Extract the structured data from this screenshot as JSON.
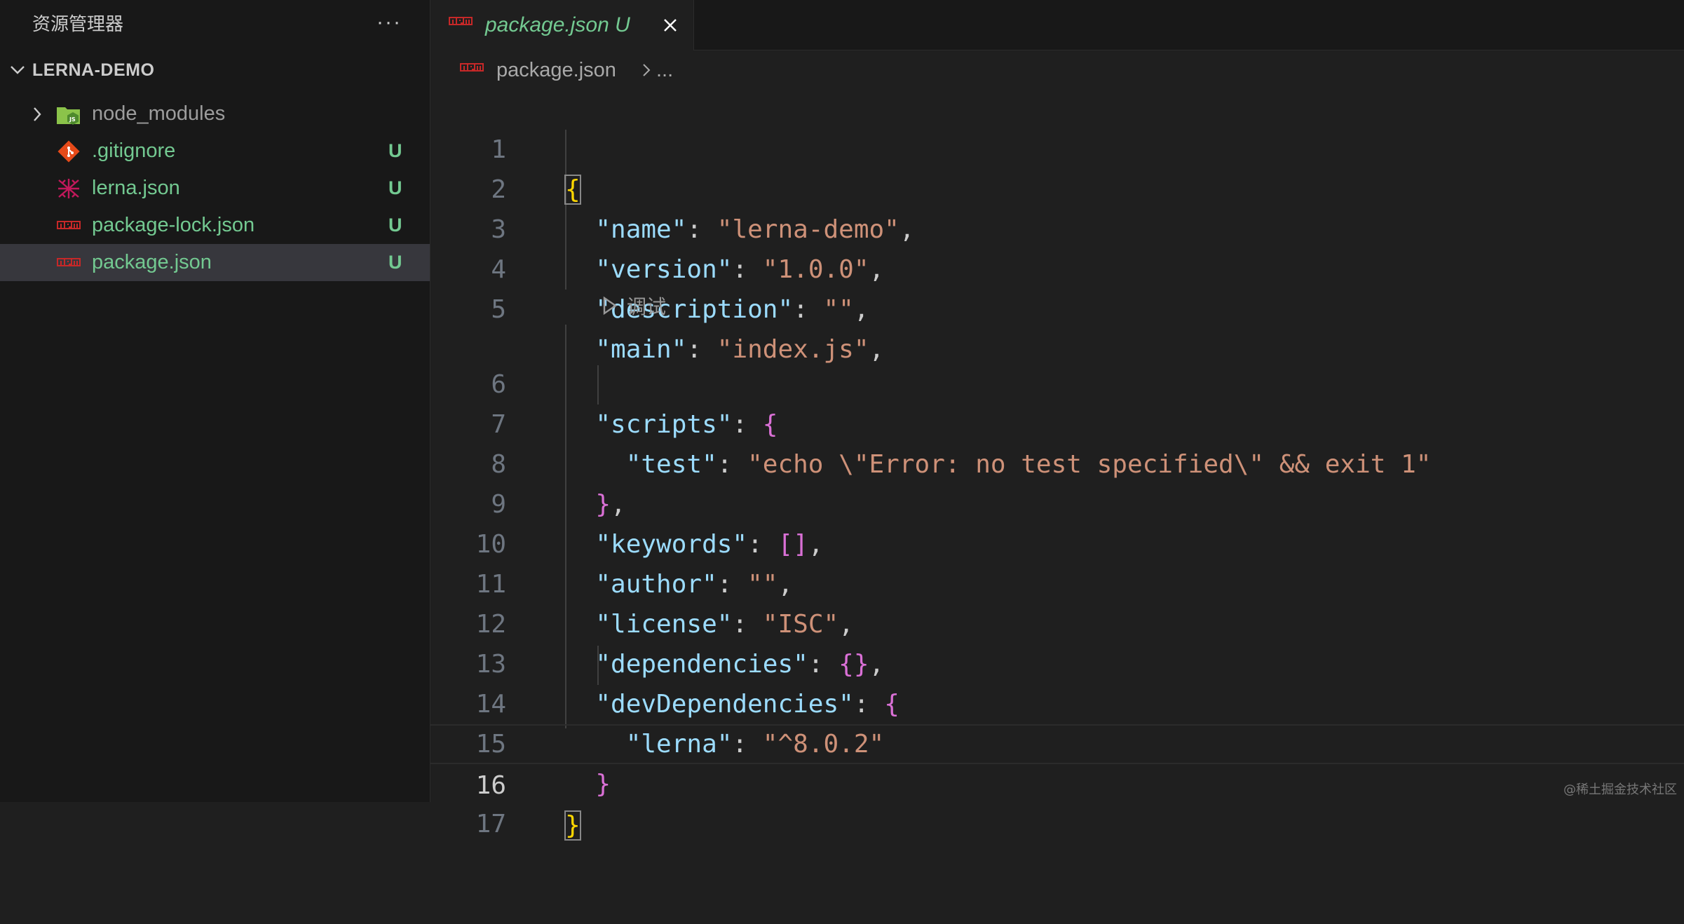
{
  "sidebar": {
    "title": "资源管理器",
    "more": "···",
    "section": "LERNA-DEMO",
    "items": [
      {
        "name": "node_modules",
        "icon": "node-modules-folder-icon",
        "badge": "",
        "type": "folder"
      },
      {
        "name": ".gitignore",
        "icon": "git-icon",
        "badge": "U"
      },
      {
        "name": "lerna.json",
        "icon": "lerna-icon",
        "badge": "U"
      },
      {
        "name": "package-lock.json",
        "icon": "npm-icon",
        "badge": "U"
      },
      {
        "name": "package.json",
        "icon": "npm-icon",
        "badge": "U",
        "selected": true
      }
    ]
  },
  "tab": {
    "label": "package.json",
    "status": "U"
  },
  "breadcrumb": {
    "file": "package.json",
    "more": "..."
  },
  "codelens": {
    "label": "调试"
  },
  "editor": {
    "active_line": 16,
    "lines": [
      {
        "n": "1"
      },
      {
        "n": "2"
      },
      {
        "n": "3"
      },
      {
        "n": "4"
      },
      {
        "n": "5"
      },
      {
        "n": "6"
      },
      {
        "n": "7"
      },
      {
        "n": "8"
      },
      {
        "n": "9"
      },
      {
        "n": "10"
      },
      {
        "n": "11"
      },
      {
        "n": "12"
      },
      {
        "n": "13"
      },
      {
        "n": "14"
      },
      {
        "n": "15"
      },
      {
        "n": "16"
      },
      {
        "n": "17"
      }
    ],
    "code": {
      "name_key": "\"name\"",
      "name_val": "\"lerna-demo\"",
      "version_key": "\"version\"",
      "version_val": "\"1.0.0\"",
      "description_key": "\"description\"",
      "description_val": "\"\"",
      "main_key": "\"main\"",
      "main_val": "\"index.js\"",
      "scripts_key": "\"scripts\"",
      "test_key": "\"test\"",
      "test_val": "\"echo \\\"Error: no test specified\\\" && exit 1\"",
      "keywords_key": "\"keywords\"",
      "keywords_val": "[]",
      "author_key": "\"author\"",
      "author_val": "\"\"",
      "license_key": "\"license\"",
      "license_val": "\"ISC\"",
      "dependencies_key": "\"dependencies\"",
      "dependencies_val": "{}",
      "devDependencies_key": "\"devDependencies\"",
      "lerna_key": "\"lerna\"",
      "lerna_val": "\"^8.0.2\""
    }
  },
  "watermark": "@稀土掘金技术社区",
  "colors": {
    "key": "#9cdcfe",
    "string": "#ce9178",
    "bracket_level1": "#ffd700",
    "bracket_level2": "#da70d6",
    "git_untracked": "#73c991"
  }
}
